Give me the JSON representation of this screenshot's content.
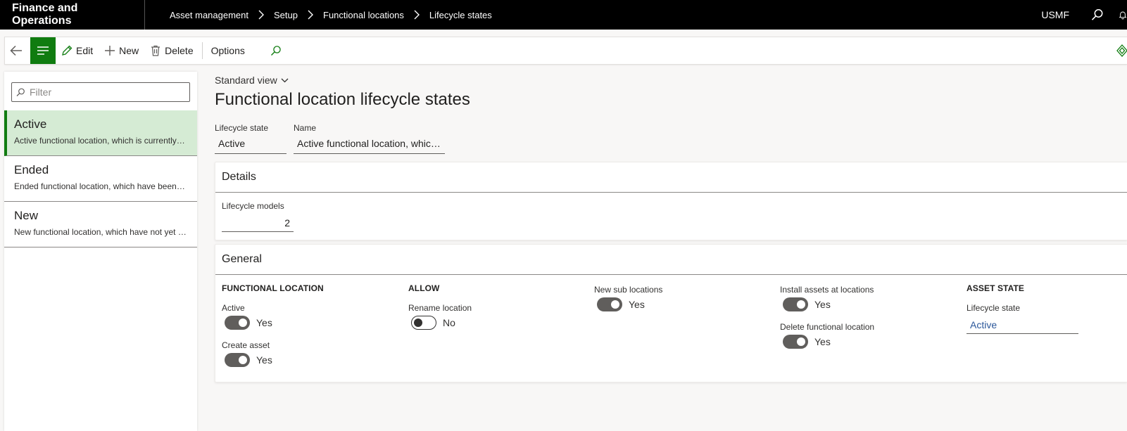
{
  "app": {
    "title": "Finance and Operations",
    "company": "USMF"
  },
  "breadcrumbs": [
    "Asset management",
    "Setup",
    "Functional locations",
    "Lifecycle states"
  ],
  "toolbar": {
    "edit": "Edit",
    "new": "New",
    "delete": "Delete",
    "options": "Options"
  },
  "filter": {
    "placeholder": "Filter"
  },
  "list": [
    {
      "title": "Active",
      "desc": "Active functional location, which is currently in use"
    },
    {
      "title": "Ended",
      "desc": "Ended functional location, which have been taken out of use"
    },
    {
      "title": "New",
      "desc": "New functional location, which have not yet been taken into use"
    }
  ],
  "main": {
    "view": "Standard view",
    "title": "Functional location lifecycle states",
    "lifecycle_state_label": "Lifecycle state",
    "lifecycle_state_value": "Active",
    "name_label": "Name",
    "name_value": "Active functional location, which is currently in use"
  },
  "details": {
    "header": "Details",
    "lifecycle_models_label": "Lifecycle models",
    "lifecycle_models_value": "2"
  },
  "general": {
    "header": "General",
    "functional_location_title": "FUNCTIONAL LOCATION",
    "active_label": "Active",
    "active_value": "Yes",
    "create_asset_label": "Create asset",
    "create_asset_value": "Yes",
    "allow_title": "ALLOW",
    "rename_label": "Rename location",
    "rename_value": "No",
    "new_sub_label": "New sub locations",
    "new_sub_value": "Yes",
    "install_label": "Install assets at locations",
    "install_value": "Yes",
    "delete_fl_label": "Delete functional location",
    "delete_fl_value": "Yes",
    "asset_state_title": "ASSET STATE",
    "asset_lifecycle_label": "Lifecycle state",
    "asset_lifecycle_value": "Active"
  },
  "colors": {
    "accent": "#107c10",
    "selected_bg": "#d5ebd4",
    "link": "#2b579a",
    "topbar": "#000000"
  }
}
